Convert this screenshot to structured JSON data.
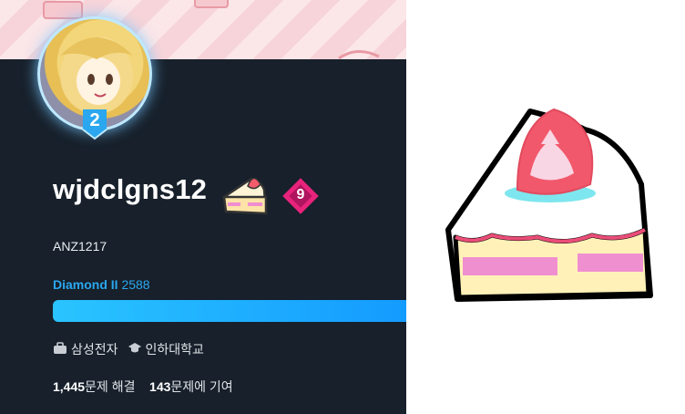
{
  "profile": {
    "username": "wjdclgns12",
    "handle": "ANZ1217",
    "tier_level": "2",
    "rank_badge_number": "9",
    "tier_name": "Diamond II",
    "rating": "2588",
    "progress": 1.0,
    "company": "삼성전자",
    "school": "인하대학교",
    "solved_count": "1,445",
    "solved_label": "문제 해결",
    "contrib_count": "143",
    "contrib_label": "문제에 기여"
  },
  "icons": {
    "tier_badge": "tier-shield-icon",
    "class_badge": "strawberry-cake-icon",
    "rank_badge": "diamond-rank-icon",
    "company": "briefcase-icon",
    "school": "graduation-cap-icon"
  },
  "colors": {
    "card_bg": "#17202b",
    "accent": "#2aa7ee",
    "rank_badge": "#e8237c"
  }
}
